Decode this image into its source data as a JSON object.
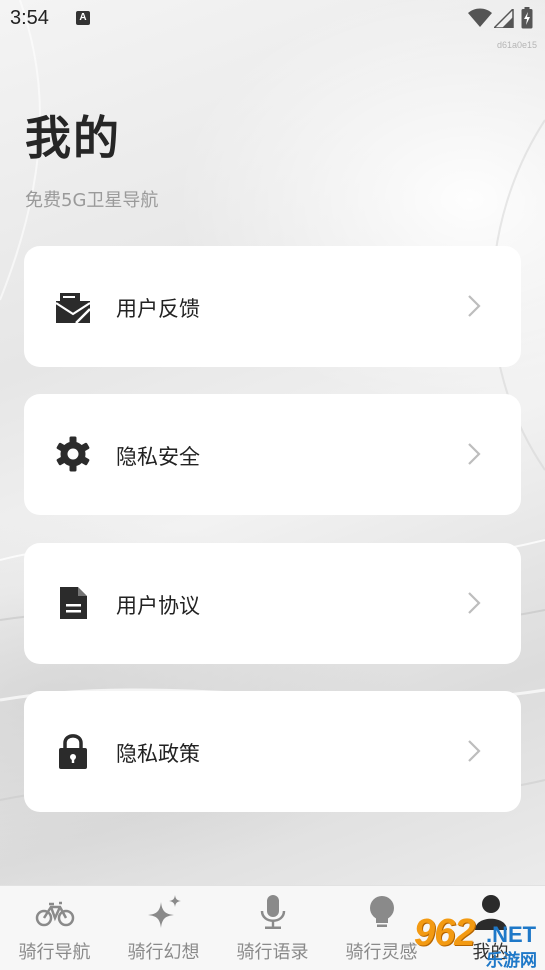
{
  "status_bar": {
    "time": "3:54",
    "notification_icon": "A",
    "icons": [
      "wifi-icon",
      "signal-icon",
      "battery-icon"
    ]
  },
  "build_id": "d61a0e15",
  "header": {
    "title": "我的",
    "subtitle": "免费5G卫星导航"
  },
  "menu": [
    {
      "label": "用户反馈",
      "icon": "feedback-mail-icon"
    },
    {
      "label": "隐私安全",
      "icon": "gear-icon"
    },
    {
      "label": "用户协议",
      "icon": "document-icon"
    },
    {
      "label": "隐私政策",
      "icon": "lock-icon"
    }
  ],
  "bottom_nav": {
    "items": [
      {
        "label": "骑行导航",
        "icon": "bicycle-icon",
        "active": false
      },
      {
        "label": "骑行幻想",
        "icon": "sparkle-icon",
        "active": false
      },
      {
        "label": "骑行语录",
        "icon": "microphone-icon",
        "active": false
      },
      {
        "label": "骑行灵感",
        "icon": "lightbulb-icon",
        "active": false
      },
      {
        "label": "我的",
        "icon": "person-icon",
        "active": true
      }
    ]
  },
  "watermark": {
    "number": "962",
    "suffix": ".NET",
    "site": "乐游网"
  },
  "colors": {
    "card_bg": "#ffffff",
    "icon": "#2b2b2b",
    "chevron": "#bdbdbd",
    "nav_inactive": "#8a8a8a",
    "watermark_orange": "#f39a12",
    "watermark_blue": "#1e78c8"
  }
}
